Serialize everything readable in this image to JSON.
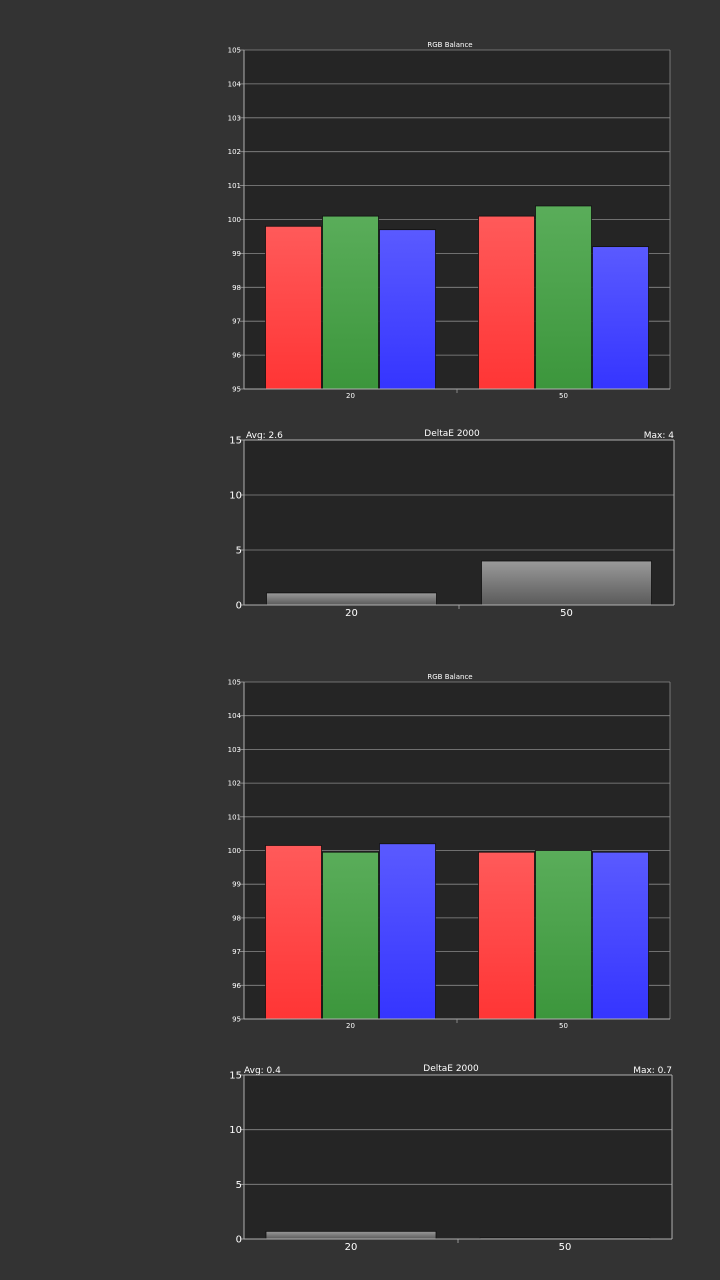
{
  "chart_data": [
    {
      "type": "bar",
      "title": "RGB Balance",
      "categories": [
        "20",
        "50"
      ],
      "series": [
        {
          "values": [
            99.8,
            100.1
          ],
          "color": "#ff4d4d"
        },
        {
          "values": [
            100.1,
            100.4
          ],
          "color": "#4ea34e"
        },
        {
          "values": [
            99.7,
            99.2
          ],
          "color": "#4d4dff"
        }
      ],
      "ylim": [
        95,
        105
      ],
      "yticks": [
        "95",
        "96",
        "97",
        "98",
        "99",
        "100",
        "101",
        "102",
        "103",
        "104",
        "105"
      ],
      "grid": true
    },
    {
      "type": "bar",
      "title": "DeltaE 2000",
      "avg_text": "Avg: 2.6",
      "max_text": "Max: 4",
      "categories": [
        "20",
        "50"
      ],
      "values": [
        1.1,
        4.0
      ],
      "ylim": [
        0,
        15
      ],
      "yticks": [
        "0",
        "5",
        "10",
        "15"
      ],
      "grid": true
    },
    {
      "type": "bar",
      "title": "RGB Balance",
      "categories": [
        "20",
        "50"
      ],
      "series": [
        {
          "values": [
            100.15,
            99.95
          ],
          "color": "#ff4d4d"
        },
        {
          "values": [
            99.95,
            100.0
          ],
          "color": "#4ea34e"
        },
        {
          "values": [
            100.2,
            99.95
          ],
          "color": "#4d4dff"
        }
      ],
      "ylim": [
        95,
        105
      ],
      "yticks": [
        "95",
        "96",
        "97",
        "98",
        "99",
        "100",
        "101",
        "102",
        "103",
        "104",
        "105"
      ],
      "grid": true
    },
    {
      "type": "bar",
      "title": "DeltaE 2000",
      "avg_text": "Avg: 0.4",
      "max_text": "Max: 0.7",
      "categories": [
        "20",
        "50"
      ],
      "values": [
        0.7,
        0.1
      ],
      "ylim": [
        0,
        15
      ],
      "yticks": [
        "0",
        "5",
        "10",
        "15"
      ],
      "grid": true
    }
  ]
}
